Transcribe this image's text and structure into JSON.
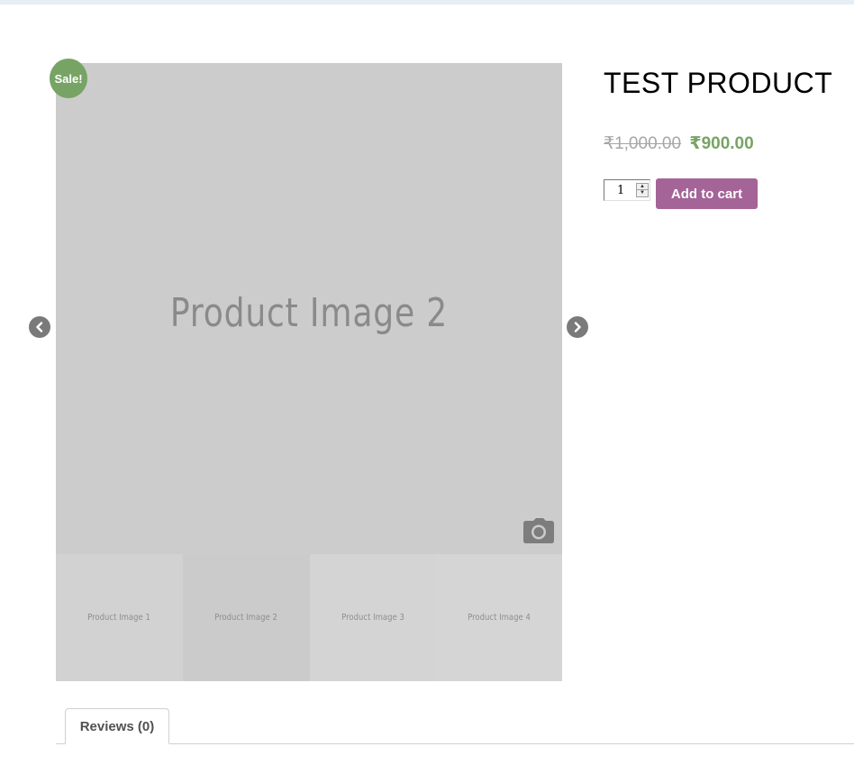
{
  "gallery": {
    "main_image_label": "Product Image 2",
    "thumbnails": [
      {
        "label": "Product Image 1"
      },
      {
        "label": "Product Image 2"
      },
      {
        "label": "Product Image 3"
      },
      {
        "label": "Product Image 4"
      }
    ],
    "sale_badge": "Sale!",
    "icons": {
      "camera": "camera-icon",
      "prev": "chevron-left-icon",
      "next": "chevron-right-icon"
    }
  },
  "product": {
    "title": "TEST PRODUCT",
    "old_price": "₹1,000.00",
    "new_price": "₹900.00",
    "quantity": "1",
    "add_to_cart_label": "Add to cart"
  },
  "tabs": [
    {
      "label": "Reviews (0)"
    }
  ],
  "colors": {
    "sale_green": "#77a464",
    "button_purple": "#a46497",
    "price_old": "#a6a6a6"
  }
}
